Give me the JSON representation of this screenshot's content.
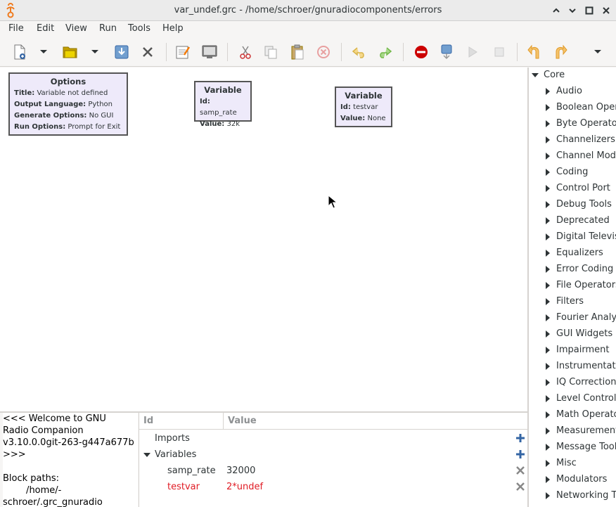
{
  "window": {
    "title": "var_undef.grc - /home/schroer/gnuradiocomponents/errors",
    "controls": [
      "chevron-up-icon",
      "chevron-down-icon",
      "maximize-icon",
      "close-icon"
    ]
  },
  "menu": [
    "File",
    "Edit",
    "View",
    "Run",
    "Tools",
    "Help"
  ],
  "toolbar": {
    "icons": [
      "new-document-icon",
      "dropdown-icon",
      "open-folder-icon",
      "dropdown-icon",
      "save-icon",
      "close-icon",
      "properties-icon",
      "screenshot-icon",
      "cut-icon",
      "copy-icon",
      "paste-icon",
      "delete-icon",
      "undo-icon",
      "redo-icon",
      "errors-icon",
      "generate-icon",
      "execute-icon",
      "kill-icon",
      "rotate-ccw-icon",
      "rotate-cw-icon",
      "more-dropdown-icon"
    ]
  },
  "canvas": {
    "options_block": {
      "title": "Options",
      "rows": [
        {
          "key": "Title:",
          "value": "Variable not defined"
        },
        {
          "key": "Output Language:",
          "value": "Python"
        },
        {
          "key": "Generate Options:",
          "value": "No GUI"
        },
        {
          "key": "Run Options:",
          "value": "Prompt for Exit"
        }
      ]
    },
    "variable_block_1": {
      "title": "Variable",
      "rows": [
        {
          "key": "Id:",
          "value": "samp_rate"
        },
        {
          "key": "Value:",
          "value": "32k"
        }
      ]
    },
    "variable_block_2": {
      "title": "Variable",
      "rows": [
        {
          "key": "Id:",
          "value": "testvar"
        },
        {
          "key": "Value:",
          "value": "None"
        }
      ]
    }
  },
  "block_tree": {
    "root": "Core",
    "items": [
      "Audio",
      "Boolean Operators",
      "Byte Operators",
      "Channelizers",
      "Channel Models",
      "Coding",
      "Control Port",
      "Debug Tools",
      "Deprecated",
      "Digital Television",
      "Equalizers",
      "Error Coding",
      "File Operators",
      "Filters",
      "Fourier Analysis",
      "GUI Widgets",
      "Impairment",
      "Instrumentation",
      "IQ Correction",
      "Level Controllers",
      "Math Operators",
      "Measurement",
      "Message Tools",
      "Misc",
      "Modulators",
      "Networking Tools"
    ]
  },
  "console": {
    "lines": [
      "<<< Welcome to GNU",
      "Radio Companion",
      "v3.10.0.0git-263-g447a677b",
      ">>>",
      "",
      "Block paths:",
      "        /home/-",
      "schroer/.grc_gnuradio"
    ]
  },
  "variables_panel": {
    "col_id": "Id",
    "col_value": "Value",
    "imports_label": "Imports",
    "variables_label": "Variables",
    "rows": [
      {
        "id": "samp_rate",
        "value": "32000",
        "error": false
      },
      {
        "id": "testvar",
        "value": "2*undef",
        "error": true
      }
    ],
    "colors": {
      "error": "#e01b24",
      "add": "#3465a4"
    }
  }
}
